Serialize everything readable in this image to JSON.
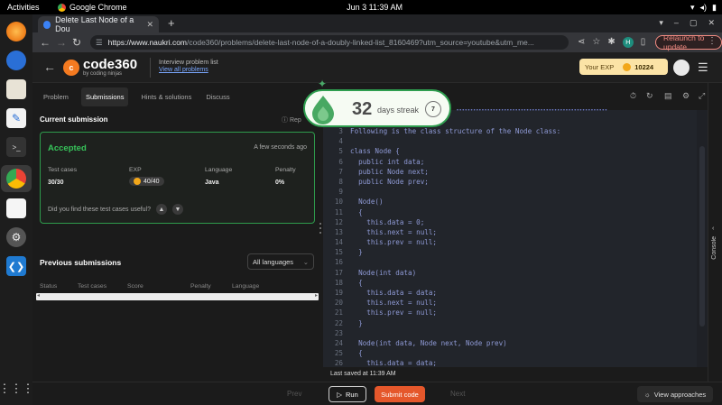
{
  "os": {
    "activities": "Activities",
    "app_name": "Google Chrome",
    "clock": "Jun 3  11:39 AM"
  },
  "browser": {
    "tab_title": "Delete Last Node of a Dou",
    "url_host": "https://www.naukri.com",
    "url_path": "/code360/problems/delete-last-node-of-a-doubly-linked-list_8160469?utm_source=youtube&utm_me...",
    "profile_initial": "H",
    "relaunch_label": "Relaunch to update"
  },
  "site": {
    "logo_main": "code360",
    "logo_sub": "by coding ninjas",
    "interview_label": "Interview problem list",
    "view_all": "View all problems",
    "exp_label": "Your EXP",
    "exp_value": "10224"
  },
  "left": {
    "tabs": [
      "Problem",
      "Submissions",
      "Hints & solutions",
      "Discuss"
    ],
    "current_title": "Current submission",
    "report": "Rep",
    "status": "Accepted",
    "time_ago": "A few seconds ago",
    "stats": [
      {
        "label": "Test cases",
        "value": "30/30"
      },
      {
        "label": "EXP",
        "value": "40/40"
      },
      {
        "label": "Language",
        "value": "Java"
      },
      {
        "label": "Penalty",
        "value": "0%"
      }
    ],
    "useful_q": "Did you find these test cases useful?",
    "prev_title": "Previous submissions",
    "lang_filter": "All languages",
    "table_headers": [
      "Status",
      "Test cases",
      "Score",
      "Penalty",
      "Language"
    ]
  },
  "streak": {
    "days": "32",
    "label": "days streak",
    "badge": "7"
  },
  "editor": {
    "line_numbers": [
      "3",
      "4",
      "5",
      "6",
      "7",
      "8",
      "9",
      "10",
      "11",
      "12",
      "13",
      "14",
      "15",
      "16",
      "17",
      "18",
      "19",
      "20",
      "21",
      "22",
      "23",
      "24",
      "25",
      "26"
    ],
    "lines": [
      "Following is the class structure of the Node class:",
      "",
      "class Node {",
      "  public int data;",
      "  public Node next;",
      "  public Node prev;",
      "",
      "  Node()",
      "  {",
      "    this.data = 0;",
      "    this.next = null;",
      "    this.prev = null;",
      "  }",
      "",
      "  Node(int data)",
      "  {",
      "    this.data = data;",
      "    this.next = null;",
      "    this.prev = null;",
      "  }",
      "",
      "  Node(int data, Node next, Node prev)",
      "  {",
      "    this.data = data;"
    ],
    "last_saved": "Last saved at 11:39 AM"
  },
  "console_label": "Console",
  "bottom": {
    "prev": "Prev",
    "run": "Run",
    "submit": "Submit code",
    "next": "Next",
    "view_approaches": "View approaches"
  }
}
